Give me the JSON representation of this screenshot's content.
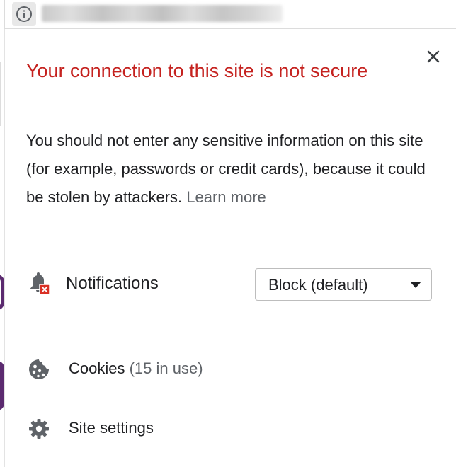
{
  "omnibox": {
    "info_icon": "info-icon",
    "url_obscured": true
  },
  "popup": {
    "title": "Your connection to this site is not secure",
    "description": "You should not enter any sensitive information on this site (for example, passwords or credit cards), because it could be stolen by attackers.",
    "learn_more": "Learn more",
    "close_icon": "close-icon",
    "notifications": {
      "icon": "bell-blocked-icon",
      "label": "Notifications",
      "selected": "Block (default)"
    },
    "cookies": {
      "icon": "cookie-icon",
      "label": "Cookies",
      "count": "(15 in use)"
    },
    "site_settings": {
      "icon": "gear-icon",
      "label": "Site settings"
    }
  },
  "colors": {
    "warning_title": "#c5221f",
    "text": "#202124",
    "secondary_text": "#5f6368",
    "icon": "#5f6368",
    "blocked_badge": "#d93025"
  }
}
